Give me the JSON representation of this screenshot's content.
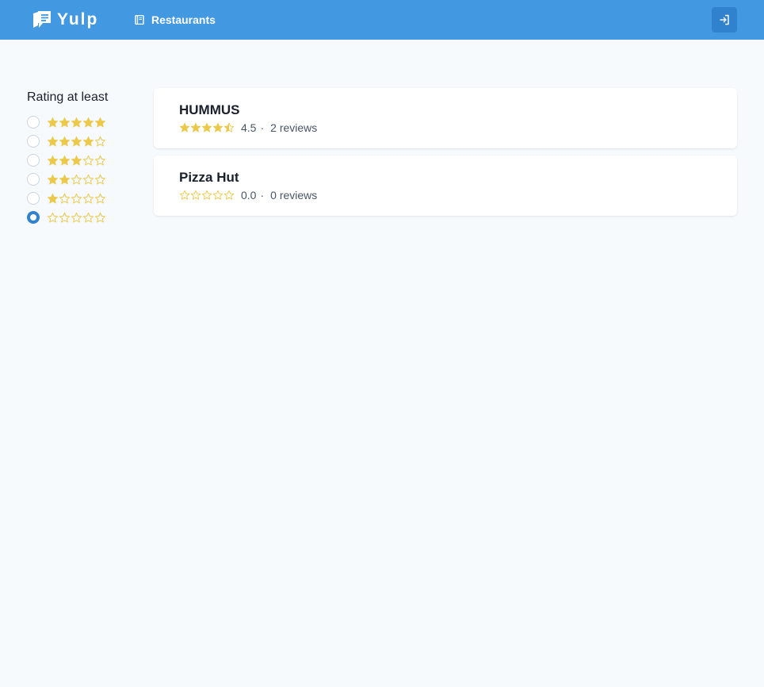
{
  "nav": {
    "brand": "Yulp",
    "brand_icon": "chat-book-icon",
    "restaurants_label": "Restaurants",
    "restaurants_icon": "book-icon",
    "login_icon": "sign-in-icon",
    "bg_color": "#4299e1"
  },
  "filter": {
    "title": "Rating at least",
    "options": [
      {
        "stars": 5,
        "selected": false
      },
      {
        "stars": 4,
        "selected": false
      },
      {
        "stars": 3,
        "selected": false
      },
      {
        "stars": 2,
        "selected": false
      },
      {
        "stars": 1,
        "selected": false
      },
      {
        "stars": 0,
        "selected": true
      }
    ]
  },
  "restaurants": [
    {
      "name": "HUMMUS",
      "rating": 4.5,
      "rating_text": "4.5",
      "reviews": "2 reviews"
    },
    {
      "name": "Pizza Hut",
      "rating": 0,
      "rating_text": "0.0",
      "reviews": "0 reviews"
    }
  ],
  "colors": {
    "star": "#ecc94b",
    "accent": "#3182ce"
  }
}
